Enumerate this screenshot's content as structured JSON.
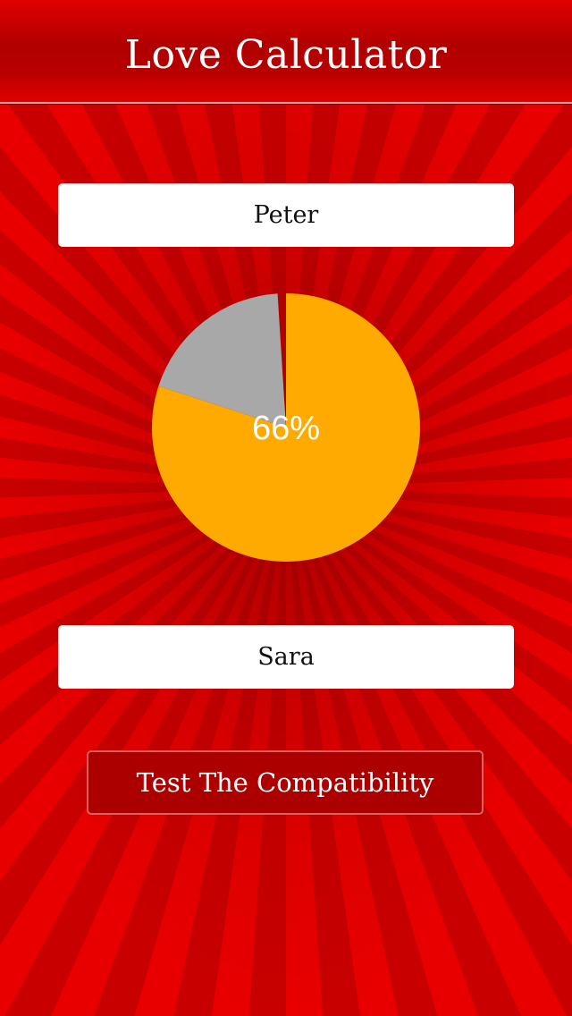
{
  "header": {
    "title": "Love Calculator"
  },
  "form": {
    "first_name": "Peter",
    "second_name": "Sara",
    "test_button_label": "Test The Compatibility"
  },
  "result": {
    "percentage_label": "66%"
  },
  "chart_data": {
    "type": "pie",
    "slices": [
      {
        "label": "",
        "value": 80,
        "color": "#ffaa00"
      },
      {
        "label": "",
        "value": 19,
        "color": "#a8a8a8"
      },
      {
        "label": "",
        "value": 1,
        "color": "transparent"
      }
    ]
  },
  "colors": {
    "background": "#d40000",
    "header": "#b00000",
    "button": "#ac0000",
    "pie_match": "#ffaa00",
    "pie_rest": "#a8a8a8"
  }
}
